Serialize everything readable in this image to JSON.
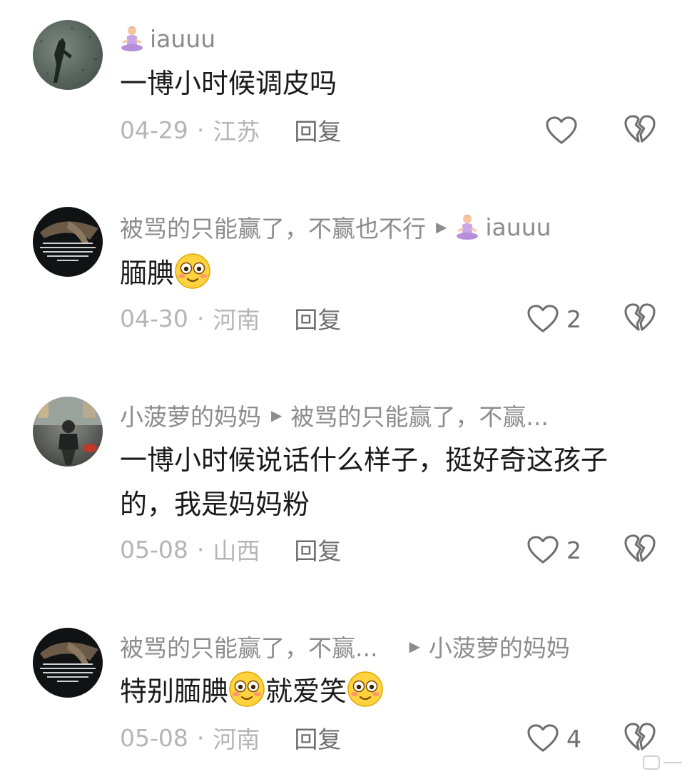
{
  "comments": [
    {
      "author": "iauuu",
      "author_emoji": "person-in-lotus-position-emoji",
      "reply_to": "",
      "text": "一博小时候调皮吗",
      "date": "04-29",
      "location": "江苏",
      "reply_label": "回复",
      "likes": ""
    },
    {
      "author": "被骂的只能赢了，不赢也不行",
      "reply_to": "iauuu",
      "reply_to_emoji": "person-in-lotus-position-emoji",
      "text": "腼腆",
      "text_emoji": "flushed-smiley-emoji",
      "date": "04-30",
      "location": "河南",
      "reply_label": "回复",
      "likes": "2"
    },
    {
      "author": "小菠萝的妈妈",
      "reply_to": "被骂的只能赢了，不赢...",
      "text_line1": "一博小时候说话什么样子，挺好奇这孩子",
      "text_line2": "的，我是妈妈粉",
      "date": "05-08",
      "location": "山西",
      "reply_label": "回复",
      "likes": "2"
    },
    {
      "author": "被骂的只能赢了，不赢...",
      "reply_to": "小菠萝的妈妈",
      "text_part1": "特别腼腆",
      "text_part2": "就爱笑",
      "text_emoji": "flushed-smiley-emoji",
      "date": "05-08",
      "location": "河南",
      "reply_label": "回复",
      "likes": "4"
    }
  ],
  "separator": "·",
  "colors": {
    "text": "#1a1a1a",
    "username": "#8c8c8c",
    "meta": "#b5b5b5",
    "action": "#6e6e6e",
    "emoji_yellow": "#ffd23f"
  }
}
